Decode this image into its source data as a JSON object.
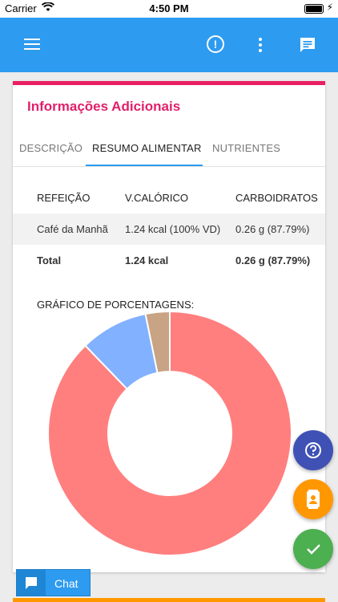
{
  "status_bar": {
    "carrier": "Carrier",
    "time": "4:50 PM"
  },
  "app_bar": {
    "color": "#2d9bf0",
    "icons": [
      "menu-icon",
      "alert-icon",
      "more-vert-icon",
      "chat-icon"
    ]
  },
  "card": {
    "title": "Informações Adicionais",
    "accent_color": "#e91e63",
    "tabs": [
      {
        "label": "DESCRIÇÃO",
        "active": false
      },
      {
        "label": "RESUMO ALIMENTAR",
        "active": true
      },
      {
        "label": "NUTRIENTES",
        "active": false
      }
    ],
    "table": {
      "headers": [
        "REFEIÇÃO",
        "V.CALÓRICO",
        "CARBOIDRATOS"
      ],
      "rows": [
        [
          "Café da Manhã",
          "1.24 kcal (100% VD)",
          "0.26 g (87.79%)"
        ]
      ],
      "total": [
        "Total",
        "1.24 kcal",
        "0.26 g (87.79%)"
      ]
    },
    "chart_title": "GRÁFICO DE PORCENTAGENS:"
  },
  "chart_data": {
    "type": "pie",
    "donut": true,
    "values": [
      87.79,
      9.0,
      3.21
    ],
    "colors": [
      "#ff7f7f",
      "#82b1ff",
      "#c8a384"
    ],
    "title": "",
    "legend": false
  },
  "fabs": [
    {
      "name": "help",
      "icon": "help-icon",
      "color": "#3f51b5"
    },
    {
      "name": "contact",
      "icon": "contact-icon",
      "color": "#ff9800"
    },
    {
      "name": "confirm",
      "icon": "check-icon",
      "color": "#4caf50"
    }
  ],
  "chat_button": {
    "label": "Chat"
  }
}
